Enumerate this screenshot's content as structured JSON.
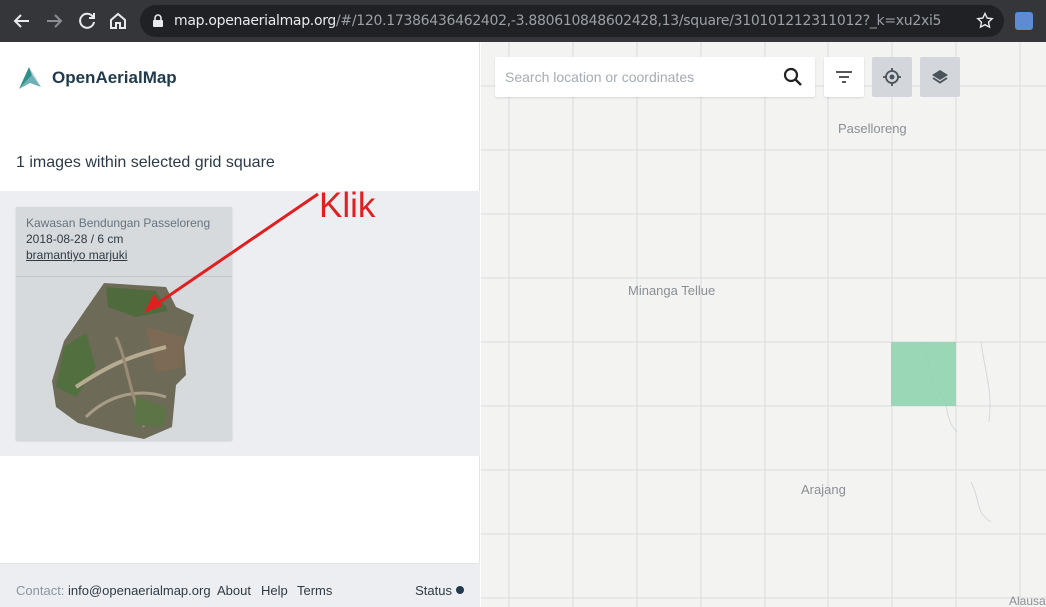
{
  "browser": {
    "url_domain": "map.openaerialmap.org",
    "url_path": "/#/120.17386436462402,-3.880610848602428,13/square/310101212311012?_k=xu2xi5"
  },
  "app": {
    "name": "OpenAerialMap",
    "results_heading": "1 images within selected grid square"
  },
  "result_card": {
    "title": "Kawasan Bendungan Passeloreng",
    "meta": "2018-08-28 / 6 cm",
    "author": "bramantiyo marjuki"
  },
  "annotation": {
    "text": "Klik",
    "color": "#e02020"
  },
  "footer": {
    "contact_label": "Contact:",
    "contact_email": "info@openaerialmap.org",
    "links": [
      "About",
      "Help",
      "Terms"
    ],
    "status": "Status"
  },
  "map": {
    "search_placeholder": "Search location or coordinates",
    "labels": [
      "Paselloreng",
      "Minanga Tellue",
      "Arajang",
      "Alausa"
    ],
    "selected_square_color": "#8fd4b0"
  },
  "icons": {
    "back": "back-arrow-icon",
    "forward": "forward-arrow-icon",
    "reload": "reload-icon",
    "home": "home-icon",
    "lock": "lock-icon",
    "star": "star-icon",
    "search": "search-icon",
    "filter": "filter-icon",
    "locate": "locate-icon",
    "layers": "layers-icon"
  }
}
